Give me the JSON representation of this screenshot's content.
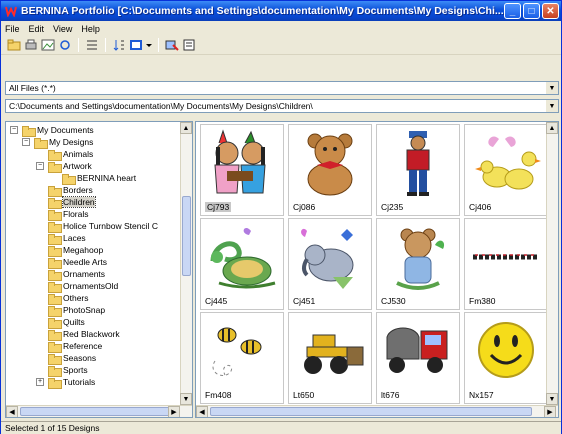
{
  "window": {
    "title": "BERNINA Portfolio  [C:\\Documents and Settings\\documentation\\My Documents\\My Designs\\Chi...",
    "minimize": "_",
    "maximize": "□",
    "close": "✕"
  },
  "menu": [
    "File",
    "Edit",
    "View",
    "Help"
  ],
  "filter": {
    "value": "All Files (*.*)"
  },
  "path": {
    "value": "C:\\Documents and Settings\\documentation\\My Documents\\My Designs\\Children\\"
  },
  "tree": {
    "items": [
      {
        "label": "My Documents"
      },
      {
        "label": "My Designs"
      },
      {
        "label": "Animals"
      },
      {
        "label": "Artwork"
      },
      {
        "label": "BERNINA heart"
      },
      {
        "label": "Borders"
      },
      {
        "label": "Children"
      },
      {
        "label": "Florals"
      },
      {
        "label": "Holice Turnbow Stencil C"
      },
      {
        "label": "Laces"
      },
      {
        "label": "Megahoop"
      },
      {
        "label": "Needle Arts"
      },
      {
        "label": "Ornaments"
      },
      {
        "label": "OrnamentsOld"
      },
      {
        "label": "Others"
      },
      {
        "label": "PhotoSnap"
      },
      {
        "label": "Quilts"
      },
      {
        "label": "Red Blackwork"
      },
      {
        "label": "Reference"
      },
      {
        "label": "Seasons"
      },
      {
        "label": "Sports"
      },
      {
        "label": "Tutorials"
      }
    ],
    "selected": "Children"
  },
  "designs": [
    {
      "name": "Cj793",
      "icon": "native-children-design"
    },
    {
      "name": "Cj086",
      "icon": "teddy-bear-design"
    },
    {
      "name": "Cj235",
      "icon": "boy-design"
    },
    {
      "name": "Cj406",
      "icon": "ducks-design"
    },
    {
      "name": "Cj445",
      "icon": "turtle-design"
    },
    {
      "name": "Cj451",
      "icon": "elephant-design"
    },
    {
      "name": "CJ530",
      "icon": "bear-butterfly-design"
    },
    {
      "name": "Fm380",
      "icon": "text-border-design"
    },
    {
      "name": "Fm408",
      "icon": "bees-design"
    },
    {
      "name": "Lt650",
      "icon": "bulldozer-design"
    },
    {
      "name": "lt676",
      "icon": "truck-design"
    },
    {
      "name": "Nx157",
      "icon": "smiley-face-design"
    }
  ],
  "status": {
    "text": "Selected 1 of 15 Designs"
  },
  "colors": {
    "title_bar": "#0a4fd8",
    "selection": "#c8c8c8",
    "folder": "#f5d36a"
  }
}
